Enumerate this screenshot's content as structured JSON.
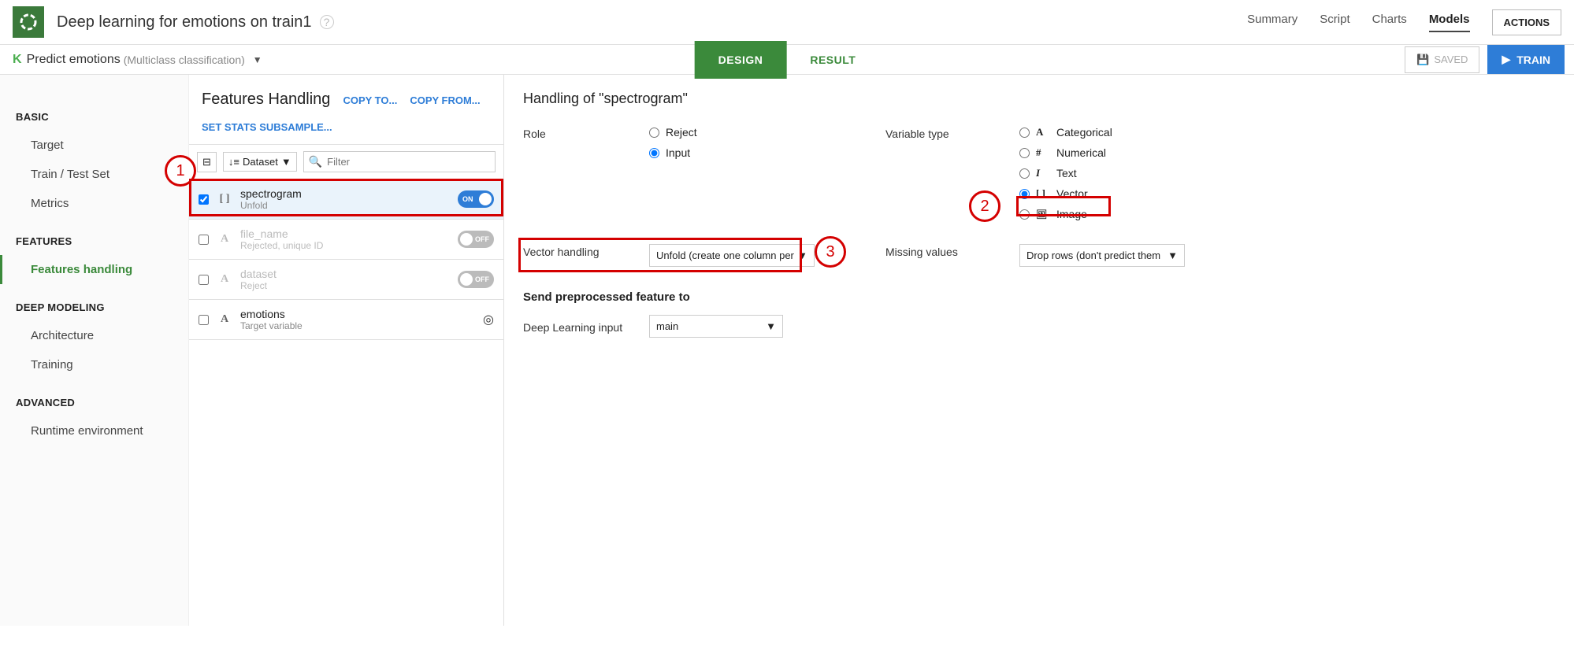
{
  "header": {
    "title": "Deep learning for emotions on train1",
    "nav": {
      "summary": "Summary",
      "script": "Script",
      "charts": "Charts",
      "models": "Models",
      "active": "Models"
    },
    "actions_label": "ACTIONS"
  },
  "subheader": {
    "k": "K",
    "title": "Predict emotions",
    "meta": "(Multiclass classification)",
    "tabs": {
      "design": "DESIGN",
      "result": "RESULT"
    },
    "saved_label": "SAVED",
    "train_label": "TRAIN"
  },
  "sidebar": {
    "sections": {
      "basic": "BASIC",
      "features": "FEATURES",
      "deep": "DEEP MODELING",
      "advanced": "ADVANCED"
    },
    "items": {
      "target": "Target",
      "traintest": "Train / Test Set",
      "metrics": "Metrics",
      "features_handling": "Features handling",
      "architecture": "Architecture",
      "training": "Training",
      "runtime": "Runtime environment"
    }
  },
  "features_panel": {
    "title": "Features Handling",
    "actions": {
      "copy_to": "COPY TO...",
      "copy_from": "COPY FROM...",
      "subsample": "SET STATS SUBSAMPLE..."
    },
    "filter": {
      "dataset_label": "Dataset",
      "placeholder": "Filter"
    },
    "rows": [
      {
        "name": "spectrogram",
        "sub": "Unfold",
        "type_icon": "[ ]",
        "on": true,
        "checked": true,
        "disabled": false,
        "target": false
      },
      {
        "name": "file_name",
        "sub": "Rejected, unique ID",
        "type_icon": "A",
        "on": false,
        "checked": false,
        "disabled": true,
        "target": false
      },
      {
        "name": "dataset",
        "sub": "Reject",
        "type_icon": "A",
        "on": false,
        "checked": false,
        "disabled": true,
        "target": false
      },
      {
        "name": "emotions",
        "sub": "Target variable",
        "type_icon": "A",
        "on": false,
        "checked": false,
        "disabled": false,
        "target": true
      }
    ]
  },
  "detail": {
    "title": "Handling of \"spectrogram\"",
    "role_label": "Role",
    "role_options": {
      "reject": "Reject",
      "input": "Input"
    },
    "role_selected": "Input",
    "vartype_label": "Variable type",
    "vartype_options": {
      "categorical": "Categorical",
      "numerical": "Numerical",
      "text": "Text",
      "vector": "Vector",
      "image": "Image"
    },
    "vartype_icons": {
      "categorical": "A",
      "numerical": "#",
      "text": "I",
      "vector": "[ ]",
      "image": ""
    },
    "vartype_selected": "Vector",
    "vector_handling_label": "Vector handling",
    "vector_handling_value": "Unfold (create one column per",
    "missing_label": "Missing values",
    "missing_value": "Drop rows (don't predict them",
    "send_title": "Send preprocessed feature to",
    "dl_input_label": "Deep Learning input",
    "dl_input_value": "main"
  },
  "annotations": {
    "n1": "1",
    "n2": "2",
    "n3": "3"
  }
}
